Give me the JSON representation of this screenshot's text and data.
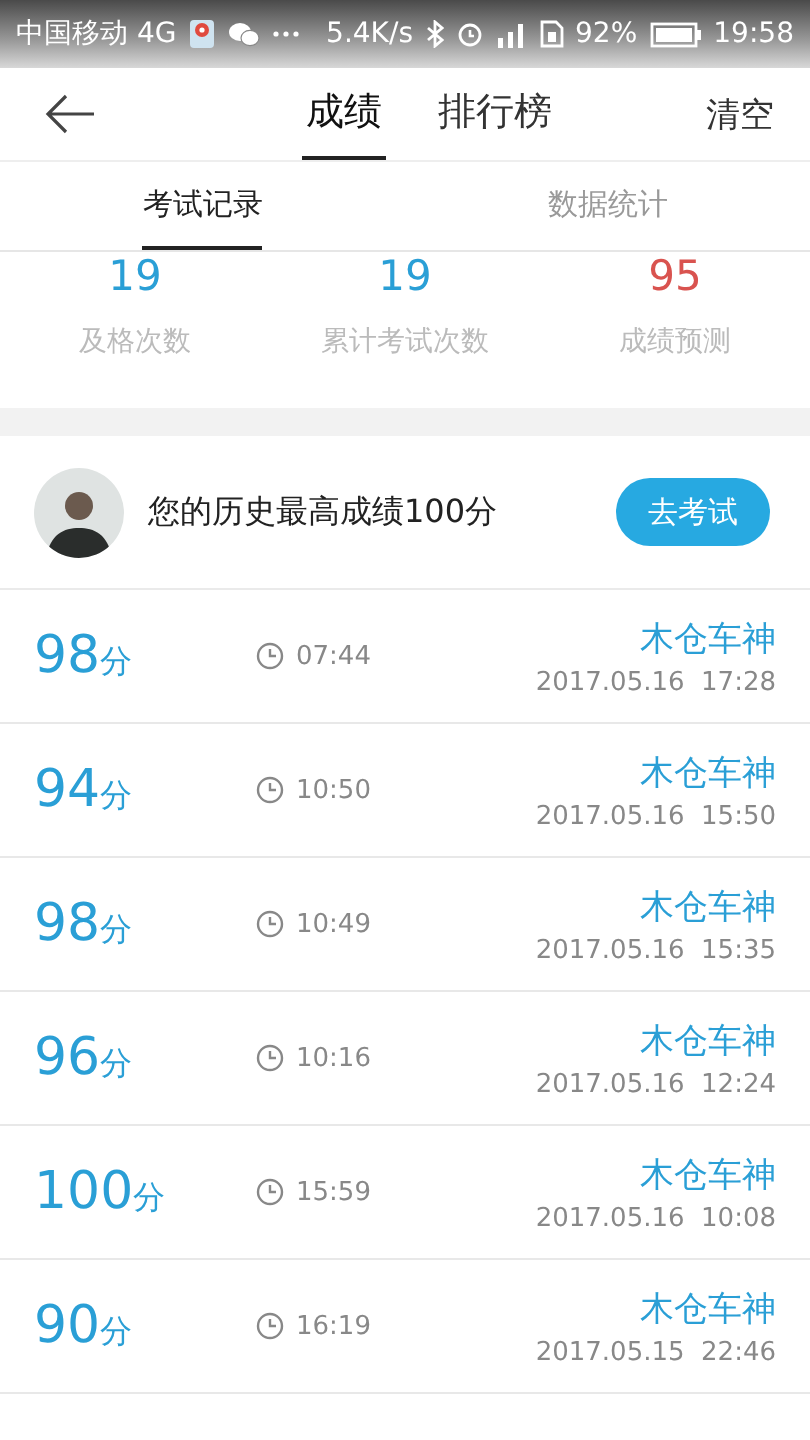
{
  "status_bar": {
    "carrier": "中国移动 4G",
    "speed": "5.4K/s",
    "battery": "92%",
    "time": "19:58"
  },
  "header": {
    "tabs": [
      {
        "label": "成绩",
        "selected": true
      },
      {
        "label": "排行榜",
        "selected": false
      }
    ],
    "action": "清空"
  },
  "sub_tabs": [
    {
      "label": "考试记录",
      "selected": true
    },
    {
      "label": "数据统计",
      "selected": false
    }
  ],
  "stats": [
    {
      "value": "19",
      "label": "及格次数",
      "color": "#2a9fd6"
    },
    {
      "value": "19",
      "label": "累计考试次数",
      "color": "#2a9fd6"
    },
    {
      "value": "95",
      "label": "成绩预测",
      "color": "#d9534f"
    }
  ],
  "best": {
    "text": "您的历史最高成绩100分",
    "button": "去考试"
  },
  "records": [
    {
      "score": "98",
      "unit": "分",
      "duration": "07:44",
      "name": "木仓车神",
      "date": "2017.05.16  17:28"
    },
    {
      "score": "94",
      "unit": "分",
      "duration": "10:50",
      "name": "木仓车神",
      "date": "2017.05.16  15:50"
    },
    {
      "score": "98",
      "unit": "分",
      "duration": "10:49",
      "name": "木仓车神",
      "date": "2017.05.16  15:35"
    },
    {
      "score": "96",
      "unit": "分",
      "duration": "10:16",
      "name": "木仓车神",
      "date": "2017.05.16  12:24"
    },
    {
      "score": "100",
      "unit": "分",
      "duration": "15:59",
      "name": "木仓车神",
      "date": "2017.05.16  10:08"
    },
    {
      "score": "90",
      "unit": "分",
      "duration": "16:19",
      "name": "木仓车神",
      "date": "2017.05.15  22:46"
    }
  ]
}
